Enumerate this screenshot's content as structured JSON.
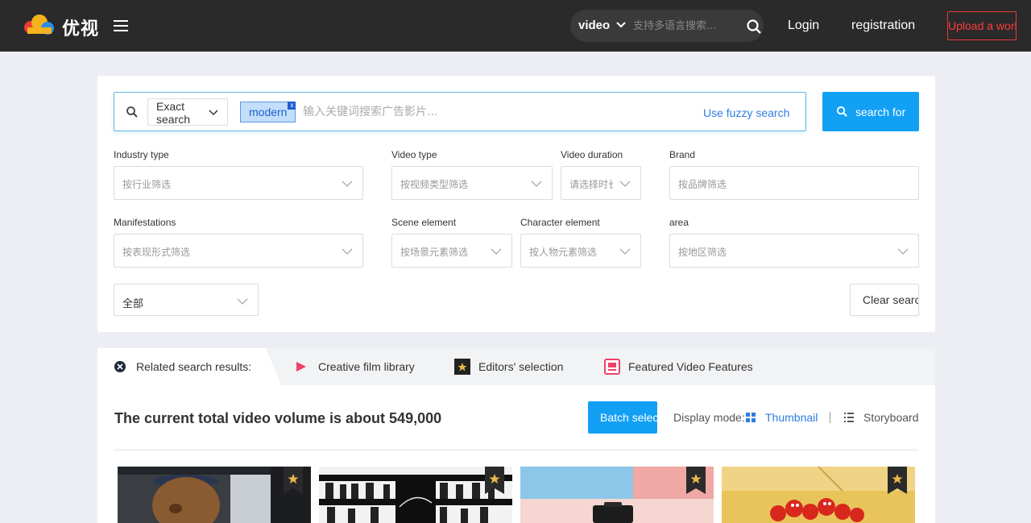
{
  "header": {
    "brand": "优视",
    "search_scope": "video",
    "search_placeholder": "支持多语言搜索...",
    "login": "Login",
    "registration": "registration",
    "upload": "Upload a work"
  },
  "search": {
    "mode": "Exact search",
    "tag": "modern",
    "tag_remove": "x",
    "keyword_placeholder": "输入关键词搜索广告影片...",
    "fuzzy_link": "Use fuzzy search",
    "search_button": "search for"
  },
  "filters": {
    "industry": {
      "label": "Industry type",
      "placeholder": "按行业筛选"
    },
    "video_type": {
      "label": "Video type",
      "placeholder": "按视频类型筛选"
    },
    "duration": {
      "label": "Video duration",
      "placeholder": "请选择时长"
    },
    "brand": {
      "label": "Brand",
      "placeholder": "按品牌筛选"
    },
    "manifestations": {
      "label": "Manifestations",
      "placeholder": "按表现形式筛选"
    },
    "scene": {
      "label": "Scene element",
      "placeholder": "按场景元素筛选"
    },
    "character": {
      "label": "Character element",
      "placeholder": "按人物元素筛选"
    },
    "area": {
      "label": "area",
      "placeholder": "按地区筛选"
    },
    "all": {
      "value": "全部"
    },
    "clear_button": "Clear search"
  },
  "results": {
    "tabs": [
      {
        "label": "Related search results:",
        "icon": "close-circle-icon"
      },
      {
        "label": "Creative film library",
        "icon": "play-triangle-icon"
      },
      {
        "label": "Editors' selection",
        "icon": "editor-badge-icon"
      },
      {
        "label": "Featured Video Features",
        "icon": "feature-tv-icon"
      }
    ],
    "total_text": "The current total video volume is about 549,000",
    "batch_button": "Batch selection",
    "display_mode_label": "Display mode:",
    "view_thumbnail": "Thumbnail",
    "view_storyboard": "Storyboard"
  },
  "colors": {
    "accent_blue": "#12a0f5",
    "link_blue": "#2d7de0",
    "upload_red": "#ff3b3b",
    "header_bg": "#2a2a2a"
  }
}
